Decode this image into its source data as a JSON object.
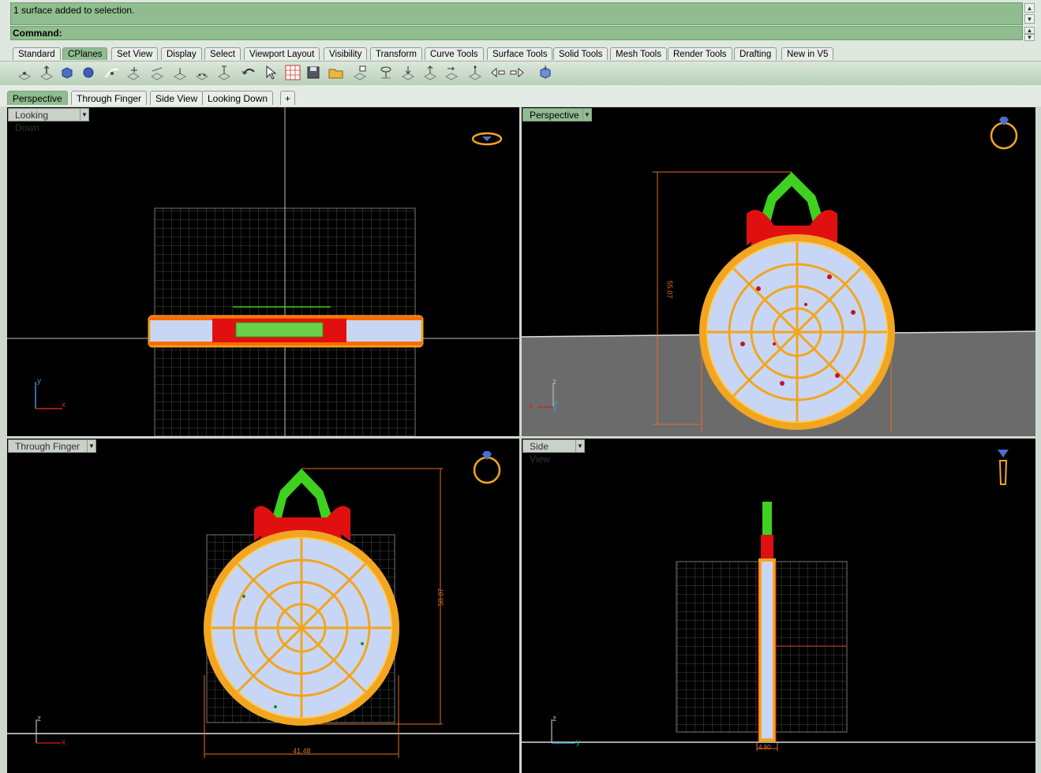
{
  "command": {
    "history_text": "1 surface added to selection.",
    "prompt_label": "Command:"
  },
  "toolbar_tabs": [
    "Standard",
    "CPlanes",
    "Set View",
    "Display",
    "Select",
    "Viewport Layout",
    "Visibility",
    "Transform",
    "Curve Tools",
    "Surface Tools",
    "Solid Tools",
    "Mesh Tools",
    "Render Tools",
    "Drafting",
    "New in V5"
  ],
  "active_toolbar_tab": "CPlanes",
  "viewport_tabs": [
    "Perspective",
    "Through Finger",
    "Side View",
    "Looking Down"
  ],
  "active_viewport_tab": "Perspective",
  "viewports": {
    "top_left": {
      "title": "Looking Down",
      "axis_a": "y",
      "axis_b": "x"
    },
    "top_right": {
      "title": "Perspective",
      "axis_a": "z",
      "axis_b": "x",
      "axis_c": "y",
      "dimension": "55.07"
    },
    "bottom_left": {
      "title": "Through Finger",
      "axis_a": "z",
      "axis_b": "x",
      "dimension_height": "58.07",
      "dimension_width": "41.48"
    },
    "bottom_right": {
      "title": "Side View",
      "axis_a": "z",
      "axis_b": "y",
      "dimension_width": "4.80"
    }
  },
  "colors": {
    "command_green": "#8fbd8f",
    "viewport_bg": "#000000",
    "grid": "#5a5a5a",
    "ring_gold": "#f2a520",
    "ring_fill": "#c8d6f5",
    "accent_red": "#e01010",
    "accent_green": "#40d020",
    "dimension": "#e07020"
  }
}
